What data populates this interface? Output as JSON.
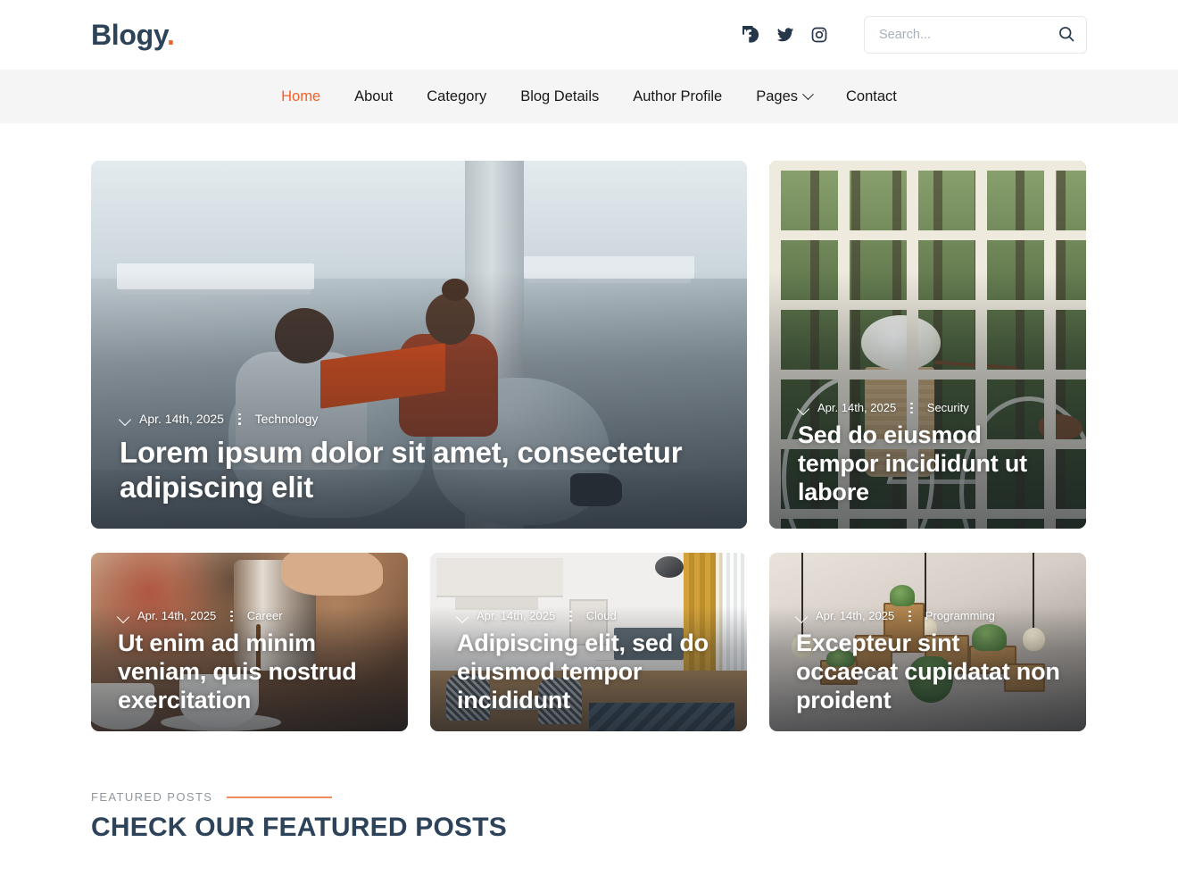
{
  "header": {
    "logo_text": "Blogy",
    "logo_dot": ".",
    "social": [
      {
        "name": "facebook-icon",
        "label": "Facebook"
      },
      {
        "name": "twitter-icon",
        "label": "Twitter"
      },
      {
        "name": "instagram-icon",
        "label": "Instagram"
      }
    ],
    "search": {
      "placeholder": "Search...",
      "value": "",
      "button_label": "Search"
    }
  },
  "nav": {
    "items": [
      {
        "label": "Home",
        "active": true
      },
      {
        "label": "About",
        "active": false
      },
      {
        "label": "Category",
        "active": false
      },
      {
        "label": "Blog Details",
        "active": false
      },
      {
        "label": "Author Profile",
        "active": false
      },
      {
        "label": "Pages",
        "active": false,
        "has_dropdown": true
      },
      {
        "label": "Contact",
        "active": false
      }
    ]
  },
  "posts": [
    {
      "date": "Apr. 14th, 2025",
      "category": "Technology",
      "title": "Lorem ipsum dolor sit amet, consectetur adipiscing elit"
    },
    {
      "date": "Apr. 14th, 2025",
      "category": "Security",
      "title": "Sed do eiusmod tempor incididunt ut labore"
    },
    {
      "date": "Apr. 14th, 2025",
      "category": "Career",
      "title": "Ut enim ad minim veniam, quis nostrud exercitation"
    },
    {
      "date": "Apr. 14th, 2025",
      "category": "Cloud",
      "title": "Adipiscing elit, sed do eiusmod tempor incididunt"
    },
    {
      "date": "Apr. 14th, 2025",
      "category": "Programming",
      "title": "Excepteur sint occaecat cupidatat non proident"
    }
  ],
  "featured": {
    "label": "FEATURED POSTS",
    "title": "CHECK OUR FEATURED POSTS"
  },
  "colors": {
    "accent": "#f2622c",
    "heading": "#2d4359",
    "nav_bg": "#f5f5f5",
    "muted": "#8f979e",
    "rule": "#ef8b5f"
  }
}
